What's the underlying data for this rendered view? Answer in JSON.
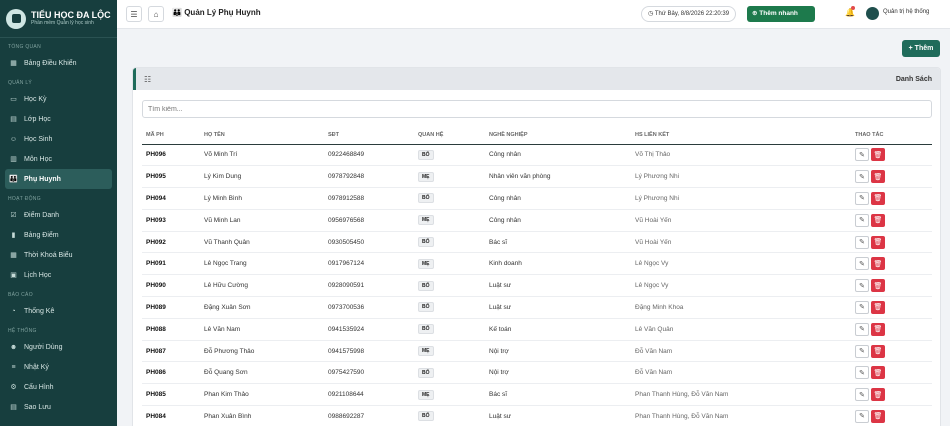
{
  "brand": {
    "title": "TIỂU HỌC ĐA LỘC",
    "subtitle": "Phần mềm Quản lý học sinh"
  },
  "sidebar": {
    "sections": [
      {
        "label": "TỔNG QUAN",
        "items": [
          {
            "label": "Bảng Điều Khiển",
            "icon": "dashboard-icon"
          }
        ]
      },
      {
        "label": "QUẢN LÝ",
        "items": [
          {
            "label": "Học Kỳ",
            "icon": "calendar-icon"
          },
          {
            "label": "Lớp Học",
            "icon": "class-icon"
          },
          {
            "label": "Học Sinh",
            "icon": "student-icon"
          },
          {
            "label": "Môn Học",
            "icon": "subject-icon"
          },
          {
            "label": "Phụ Huynh",
            "icon": "parents-icon",
            "active": true
          }
        ]
      },
      {
        "label": "HOẠT ĐỘNG",
        "items": [
          {
            "label": "Điểm Danh",
            "icon": "checklist-icon"
          },
          {
            "label": "Bảng Điểm",
            "icon": "chart-icon"
          },
          {
            "label": "Thời Khoá Biểu",
            "icon": "timetable-icon"
          },
          {
            "label": "Lịch Học",
            "icon": "schedule-icon"
          }
        ]
      },
      {
        "label": "BÁO CÁO",
        "items": [
          {
            "label": "Thống Kê",
            "icon": "pie-icon"
          }
        ]
      },
      {
        "label": "HỆ THỐNG",
        "items": [
          {
            "label": "Người Dùng",
            "icon": "users-icon"
          },
          {
            "label": "Nhật Ký",
            "icon": "log-icon"
          },
          {
            "label": "Cấu Hình",
            "icon": "gear-icon"
          },
          {
            "label": "Sao Lưu",
            "icon": "backup-icon"
          }
        ]
      }
    ]
  },
  "topbar": {
    "title": "Quản Lý Phụ Huynh",
    "datetime": "Thứ Bảy, 8/8/2026 22:20:39",
    "quick_label": "Thêm nhanh",
    "admin_label": "Quản trị hệ thống"
  },
  "add_label": "+ Thêm",
  "card": {
    "title": "Danh Sách",
    "search_placeholder": "Tìm kiếm..."
  },
  "table": {
    "headers": [
      "MÃ PH",
      "HỌ TÊN",
      "SĐT",
      "QUAN HỆ",
      "NGHỀ NGHIỆP",
      "HS LIÊN KẾT",
      "THAO TÁC"
    ],
    "rows": [
      [
        "PH096",
        "Võ Minh Trí",
        "0922468849",
        "BỐ",
        "Công nhân",
        "Võ Thị Thảo"
      ],
      [
        "PH095",
        "Lý Kim Dung",
        "0978792848",
        "MẸ",
        "Nhân viên văn phòng",
        "Lý Phương Nhi"
      ],
      [
        "PH094",
        "Lý Minh Bình",
        "0978912588",
        "BỐ",
        "Công nhân",
        "Lý Phương Nhi"
      ],
      [
        "PH093",
        "Vũ Minh Lan",
        "0956976568",
        "MẸ",
        "Công nhân",
        "Vũ Hoài Yến"
      ],
      [
        "PH092",
        "Vũ Thanh Quân",
        "0930505450",
        "BỐ",
        "Bác sĩ",
        "Vũ Hoài Yến"
      ],
      [
        "PH091",
        "Lê Ngọc Trang",
        "0917967124",
        "MẸ",
        "Kinh doanh",
        "Lê Ngọc Vy"
      ],
      [
        "PH090",
        "Lê Hữu Cường",
        "0928090591",
        "BỐ",
        "Luật sư",
        "Lê Ngọc Vy"
      ],
      [
        "PH089",
        "Đặng Xuân Sơn",
        "0973700536",
        "BỐ",
        "Luật sư",
        "Đặng Minh Khoa"
      ],
      [
        "PH088",
        "Lê Văn Nam",
        "0941535924",
        "BỐ",
        "Kế toán",
        "Lê Văn Quân"
      ],
      [
        "PH087",
        "Đỗ Phương Thảo",
        "0941575998",
        "MẸ",
        "Nội trợ",
        "Đỗ Văn Nam"
      ],
      [
        "PH086",
        "Đỗ Quang Sơn",
        "0975427590",
        "BỐ",
        "Nội trợ",
        "Đỗ Văn Nam"
      ],
      [
        "PH085",
        "Phan Kim Thảo",
        "0921108644",
        "MẸ",
        "Bác sĩ",
        "Phan Thanh Hùng, Đỗ Văn Nam"
      ],
      [
        "PH084",
        "Phan Xuân Bình",
        "0988692287",
        "BỐ",
        "Luật sư",
        "Phan Thanh Hùng, Đỗ Văn Nam"
      ]
    ]
  }
}
